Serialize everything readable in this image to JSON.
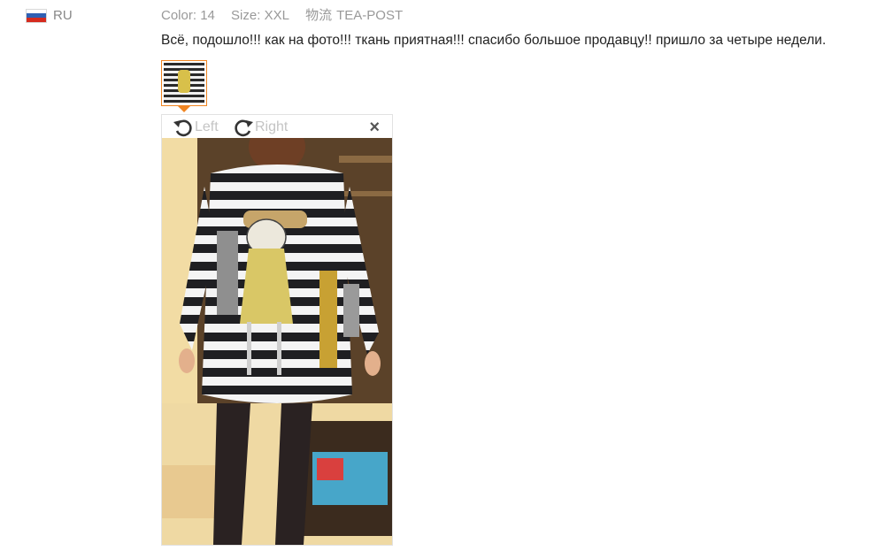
{
  "buyer": {
    "flag_icon": "russia-flag-icon",
    "country": "RU",
    "flag_colors": [
      "#ffffff",
      "#2f5fb3",
      "#d52b1e"
    ]
  },
  "meta": {
    "color_label": "Color:",
    "color_value": "14",
    "size_label": "Size:",
    "size_value": "XXL",
    "logistics_label": "物流",
    "logistics_value": "TEA-POST"
  },
  "review": {
    "text": "Всё, подошло!!! как на фото!!! ткань приятная!!! спасибо большое продавцу!! пришло за четыре недели."
  },
  "viewer": {
    "rotate_left_label": "Left",
    "rotate_right_label": "Right",
    "close_label": "×",
    "accent_color": "#f08522"
  }
}
